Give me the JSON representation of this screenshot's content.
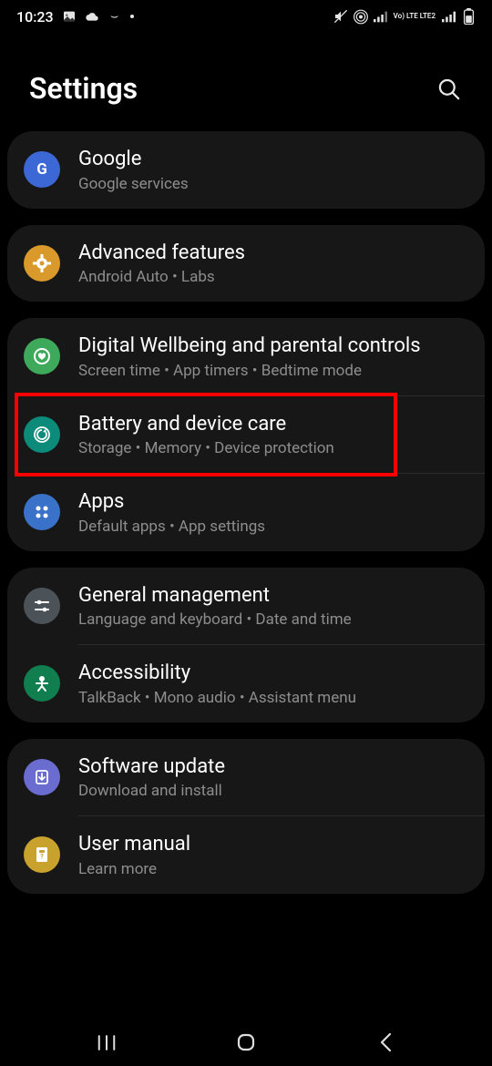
{
  "status": {
    "time": "10:23",
    "net_text": "Vo) LTE LTE2"
  },
  "header": {
    "title": "Settings"
  },
  "groups": [
    {
      "rows": [
        {
          "title": "Google",
          "subtitle": "Google services",
          "icon_bg": "#3b68d4",
          "name": "google",
          "icon": "google"
        }
      ]
    },
    {
      "rows": [
        {
          "title": "Advanced features",
          "subtitle": "Android Auto  •  Labs",
          "icon_bg": "#da9a2b",
          "name": "advanced-features",
          "icon": "gear"
        }
      ]
    },
    {
      "rows": [
        {
          "title": "Digital Wellbeing and parental controls",
          "subtitle": "Screen time  •  App timers  •  Bedtime mode",
          "icon_bg": "#3fa95b",
          "name": "digital-wellbeing",
          "icon": "heart-circle"
        },
        {
          "title": "Battery and device care",
          "subtitle": "Storage  •  Memory  •  Device protection",
          "icon_bg": "#0c8a7a",
          "name": "battery-device-care",
          "icon": "refresh-circle",
          "highlight": true
        },
        {
          "title": "Apps",
          "subtitle": "Default apps  •  App settings",
          "icon_bg": "#3a72c9",
          "name": "apps",
          "icon": "grid-dots"
        }
      ]
    },
    {
      "rows": [
        {
          "title": "General management",
          "subtitle": "Language and keyboard  •  Date and time",
          "icon_bg": "#4c5358",
          "name": "general-management",
          "icon": "sliders"
        },
        {
          "title": "Accessibility",
          "subtitle": "TalkBack  •  Mono audio  •  Assistant menu",
          "icon_bg": "#107e4e",
          "name": "accessibility",
          "icon": "person"
        }
      ]
    },
    {
      "rows": [
        {
          "title": "Software update",
          "subtitle": "Download and install",
          "icon_bg": "#6a6ccf",
          "name": "software-update",
          "icon": "download"
        },
        {
          "title": "User manual",
          "subtitle": "Learn more",
          "icon_bg": "#c9a12d",
          "name": "user-manual",
          "icon": "book"
        }
      ]
    }
  ]
}
